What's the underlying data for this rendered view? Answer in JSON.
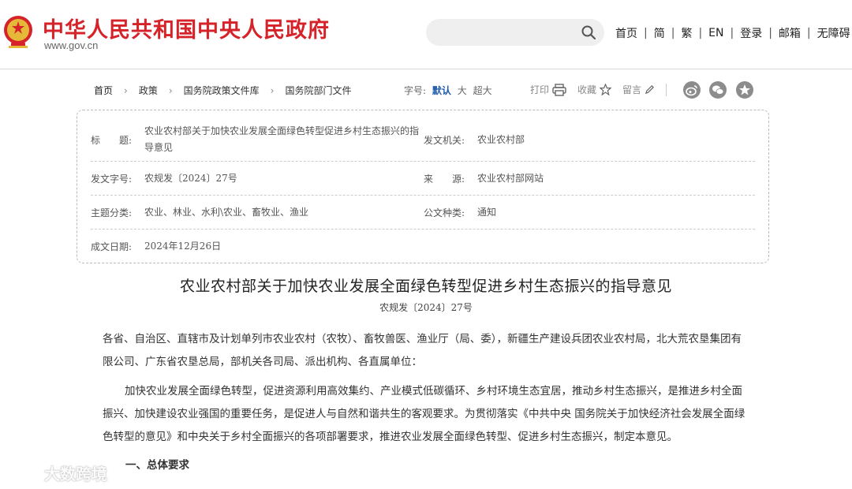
{
  "header": {
    "site_title": "中华人民共和国中央人民政府",
    "site_url": "www.gov.cn",
    "search": {
      "placeholder": ""
    },
    "nav": [
      "首页",
      "简",
      "繁",
      "EN",
      "登录",
      "邮箱",
      "无障碍"
    ],
    "brand_color": "#d6232a"
  },
  "breadcrumb": [
    "首页",
    "政策",
    "国务院政策文件库",
    "国务院部门文件"
  ],
  "font_size": {
    "label": "字号:",
    "options": [
      "默认",
      "大",
      "超大"
    ],
    "active": "默认"
  },
  "tools": {
    "print": "打印",
    "favorite": "收藏",
    "comment": "留言"
  },
  "share_icons": [
    "weibo-icon",
    "wechat-icon",
    "star-icon"
  ],
  "info": {
    "title_label": "标　　题:",
    "title_value": "农业农村部关于加快农业发展全面绿色转型促进乡村生态振兴的指导意见",
    "issuer_label": "发文机关:",
    "issuer_value": "农业农村部",
    "docno_label": "发文字号:",
    "docno_value": "农规发〔2024〕27号",
    "source_label": "来　　源:",
    "source_value": "农业农村部网站",
    "topic_label": "主题分类:",
    "topic_value": "农业、林业、水利\\农业、畜牧业、渔业",
    "type_label": "公文种类:",
    "type_value": "通知",
    "date_label": "成文日期:",
    "date_value": "2024年12月26日"
  },
  "article": {
    "title": "农业农村部关于加快农业发展全面绿色转型促进乡村生态振兴的指导意见",
    "doc_no": "农规发〔2024〕27号",
    "para1": "各省、自治区、直辖市及计划单列市农业农村（农牧）、畜牧兽医、渔业厅（局、委），新疆生产建设兵团农业农村局，北大荒农垦集团有限公司、广东省农垦总局，部机关各司局、派出机构、各直属单位：",
    "para2": "加快农业发展全面绿色转型，促进资源利用高效集约、产业模式低碳循环、乡村环境生态宜居，推动乡村生态振兴，是推进乡村全面振兴、加快建设农业强国的重要任务，是促进人与自然和谐共生的客观要求。为贯彻落实《中共中央 国务院关于加快经济社会发展全面绿色转型的意见》和中央关于乡村全面振兴的各项部署要求，推进农业发展全面绿色转型、促进乡村生态振兴，制定本意见。",
    "section1": "一、总体要求"
  },
  "watermark": "大数跨境"
}
